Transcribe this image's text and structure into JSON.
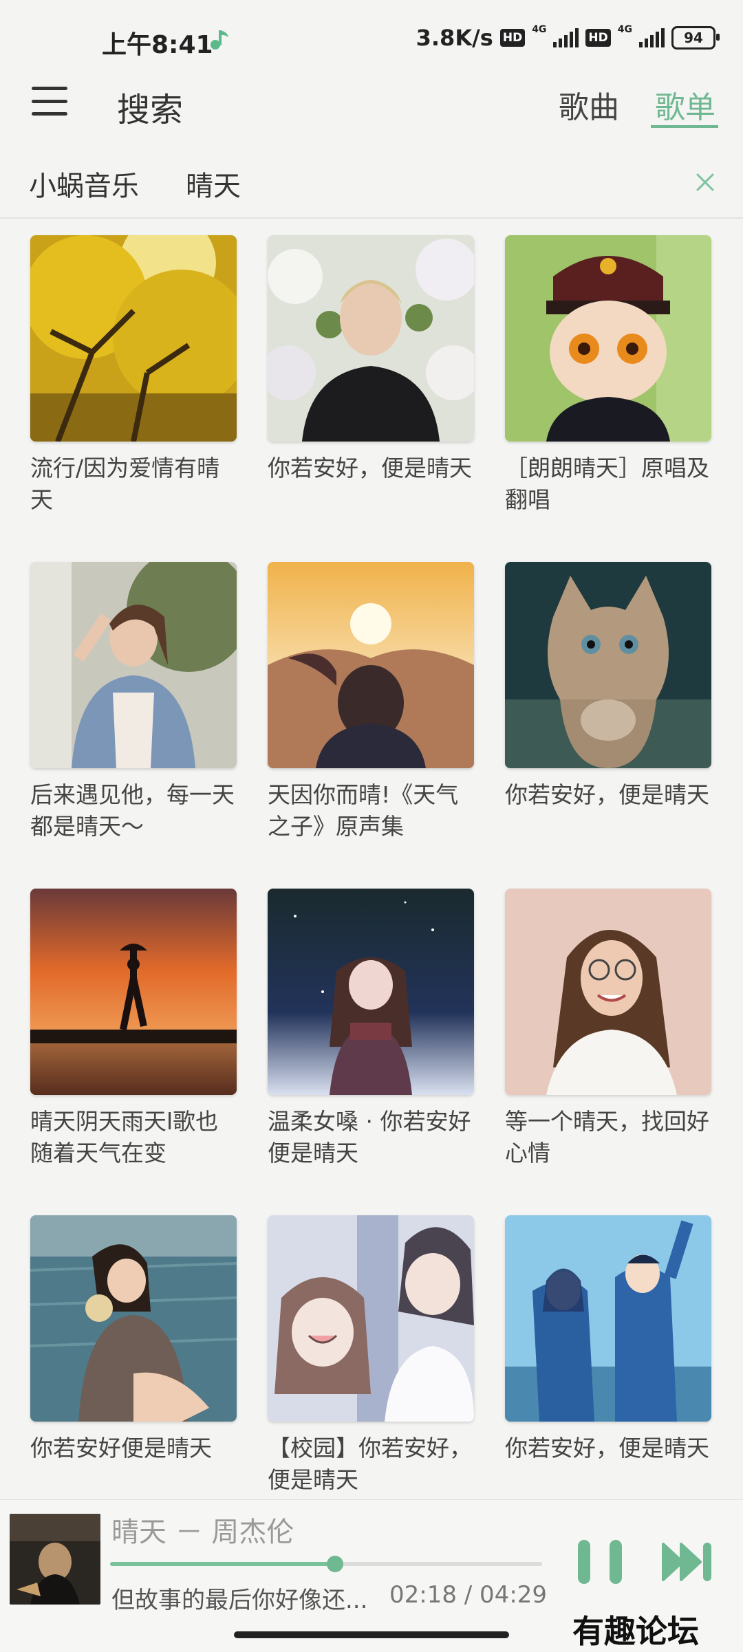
{
  "status": {
    "time": "上午8:41",
    "speed": "3.8K/s",
    "hd": "HD",
    "network": "4G",
    "battery": "94"
  },
  "header": {
    "title": "搜索",
    "tabs": [
      {
        "label": "歌曲",
        "active": false
      },
      {
        "label": "歌单",
        "active": true
      }
    ],
    "accent": "#6fb891"
  },
  "search": {
    "source": "小蜗音乐",
    "query": "晴天"
  },
  "playlists": [
    {
      "title": "流行/因为爱情有晴天"
    },
    {
      "title": "你若安好，便是晴天"
    },
    {
      "title": "［朗朗晴天］原唱及翻唱"
    },
    {
      "title": "后来遇见他，每一天都是晴天～"
    },
    {
      "title": "天因你而晴!《天气之子》原声集"
    },
    {
      "title": "你若安好，便是晴天"
    },
    {
      "title": "晴天阴天雨天l歌也随着天气在变"
    },
    {
      "title": "温柔女嗓 · 你若安好便是晴天"
    },
    {
      "title": "等一个晴天，找回好心情"
    },
    {
      "title": "你若安好便是晴天"
    },
    {
      "title": "【校园】你若安好，便是晴天"
    },
    {
      "title": "你若安好，便是晴天"
    }
  ],
  "player": {
    "title": "晴天 － 周杰伦",
    "lyric": "但故事的最后你好像还...",
    "time": "02:18 / 04:29",
    "progress": 0.52
  },
  "watermark": "有趣论坛"
}
